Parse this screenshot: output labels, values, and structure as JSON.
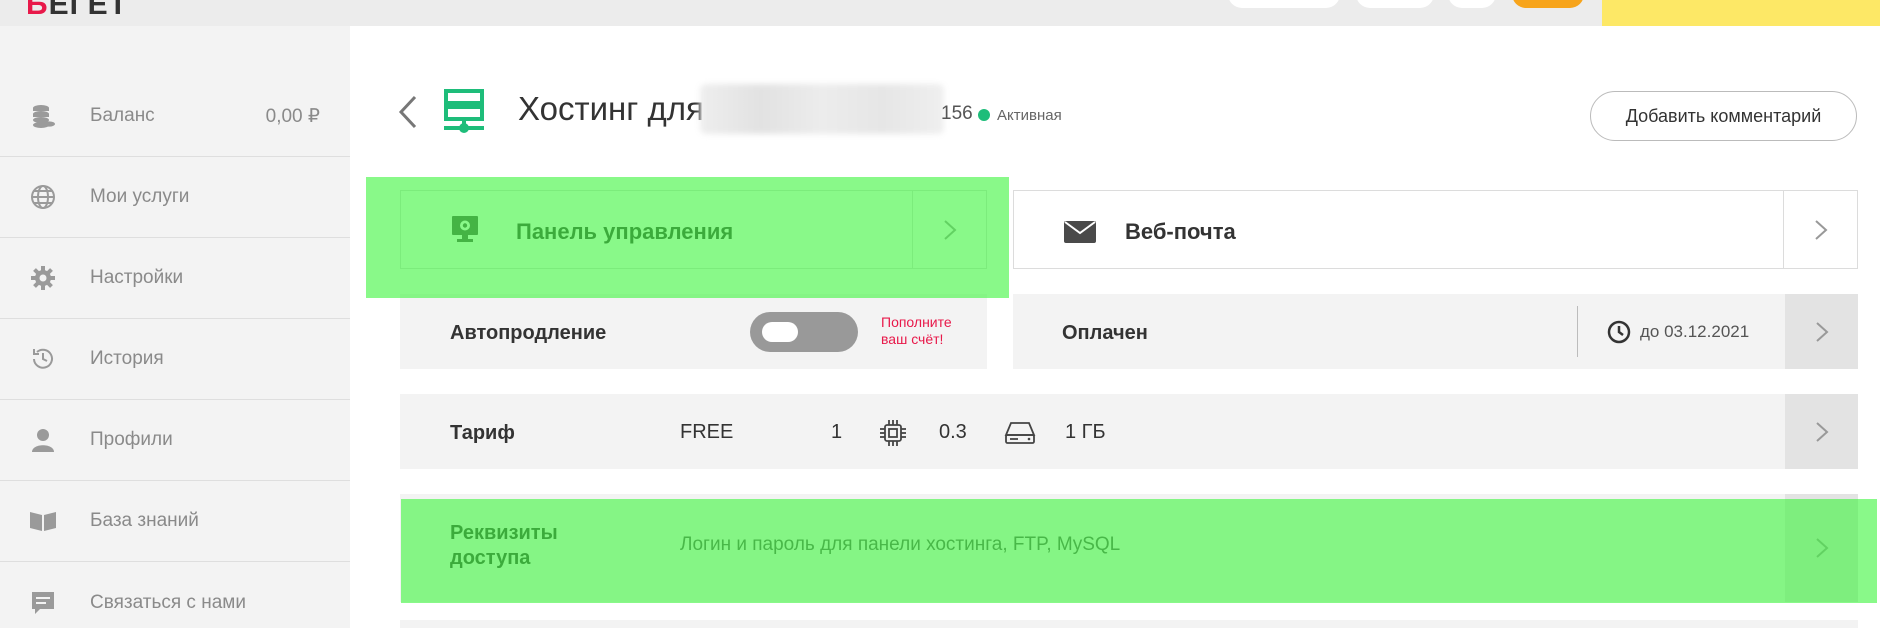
{
  "brand": {
    "logo_mark": "Б",
    "logo_text": "ЕГЕТ",
    "accent": "#e8194a",
    "success": "#1ebd7a",
    "highlight": "#40f540"
  },
  "sidebar": {
    "items": [
      {
        "label": "Баланс",
        "value": "0,00 ₽",
        "icon": "coins-icon"
      },
      {
        "label": "Мои услуги",
        "icon": "globe-icon"
      },
      {
        "label": "Настройки",
        "icon": "gear-icon"
      },
      {
        "label": "История",
        "icon": "history-icon"
      },
      {
        "label": "Профили",
        "icon": "user-icon"
      },
      {
        "label": "База знаний",
        "icon": "book-icon"
      },
      {
        "label": "Связаться с нами",
        "icon": "chat-icon"
      }
    ]
  },
  "header": {
    "title": "Хостинг для",
    "title_suffix": "156",
    "status": "Активная",
    "comment_button": "Добавить комментарий"
  },
  "cards": {
    "control_panel": {
      "label": "Панель управления",
      "icon": "monitor-gear-icon"
    },
    "webmail": {
      "label": "Веб-почта",
      "icon": "envelope-icon"
    },
    "autorenew": {
      "label": "Автопродление",
      "toggle_on": false,
      "topup_hint": "Пополните ваш счёт!"
    },
    "paid": {
      "label": "Оплачен",
      "until": "до 03.12.2021",
      "icon": "clock-icon"
    },
    "tariff": {
      "label": "Тариф",
      "plan": "FREE",
      "cpu": "1",
      "ram": "0.3",
      "disk": "1 ГБ"
    },
    "access": {
      "label": "Реквизиты доступа",
      "description": "Логин и пароль для панели хостинга, FTP, MySQL"
    }
  }
}
